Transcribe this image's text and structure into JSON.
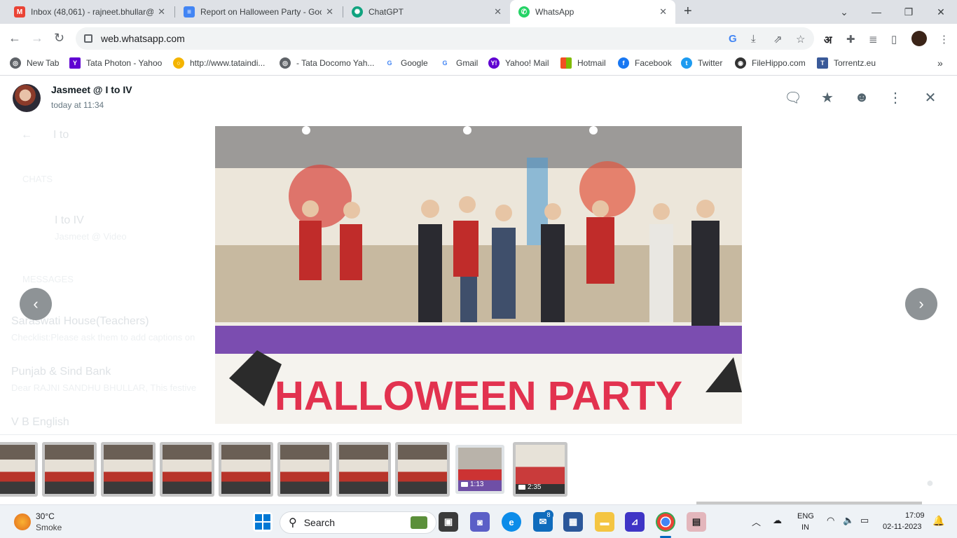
{
  "tabs": [
    {
      "title": "Inbox (48,061) - rajneet.bhullar@",
      "icon": "gmail-icon",
      "color": "#ea4335"
    },
    {
      "title": "Report on Halloween Party - Goo",
      "icon": "google-docs-icon",
      "color": "#4285f4"
    },
    {
      "title": "ChatGPT",
      "icon": "chatgpt-icon",
      "color": "#10a37f"
    },
    {
      "title": "WhatsApp",
      "icon": "whatsapp-icon",
      "color": "#25d366"
    }
  ],
  "address": {
    "url": "web.whatsapp.com"
  },
  "bookmarks": [
    {
      "label": "New Tab",
      "color": "#5f6368"
    },
    {
      "label": "Tata Photon - Yahoo",
      "color": "#6001d2"
    },
    {
      "label": "http://www.tataindi...",
      "color": "#f4b400"
    },
    {
      "label": "- Tata Docomo Yah...",
      "color": "#5f6368"
    },
    {
      "label": "Google",
      "color": "#4285f4"
    },
    {
      "label": "Gmail",
      "color": "#4285f4"
    },
    {
      "label": "Yahoo! Mail",
      "color": "#6001d2"
    },
    {
      "label": "Hotmail",
      "color": "#f25022"
    },
    {
      "label": "Facebook",
      "color": "#1877f2"
    },
    {
      "label": "Twitter",
      "color": "#1d9bf0"
    },
    {
      "label": "FileHippo.com",
      "color": "#333333"
    },
    {
      "label": "Torrentz.eu",
      "color": "#3a5a99"
    }
  ],
  "viewer": {
    "sender": "Jasmeet @ I to IV",
    "time": "today at 11:34"
  },
  "background_chat": {
    "search": "I to",
    "chats_heading": "CHATS",
    "chat_name": "I to IV",
    "chat_preview": "Jasmeet @ Video",
    "messages_heading": "MESSAGES",
    "results": [
      {
        "name": "Saraswati House(Teachers)",
        "preview": "Checklist:Please ask them to add captions on"
      },
      {
        "name": "Punjab & Sind Bank",
        "preview": "Dear RAJNI SANDHU BHULLAR, This festive"
      },
      {
        "name": "V B English",
        "preview": ""
      }
    ]
  },
  "thumbnails": [
    {
      "duration": ""
    },
    {
      "duration": ""
    },
    {
      "duration": ""
    },
    {
      "duration": ""
    },
    {
      "duration": ""
    },
    {
      "duration": ""
    },
    {
      "duration": ""
    },
    {
      "duration": ""
    },
    {
      "duration": "1:13"
    },
    {
      "duration": "2:35"
    }
  ],
  "taskbar": {
    "weather_temp": "30°C",
    "weather_desc": "Smoke",
    "search_label": "Search",
    "lang_top": "ENG",
    "lang_bottom": "IN",
    "clock_time": "17:09",
    "clock_date": "02-11-2023",
    "mail_badge": "8"
  },
  "colors": {
    "whatsapp_green": "#25d366",
    "tabbar": "#dee1e6"
  }
}
